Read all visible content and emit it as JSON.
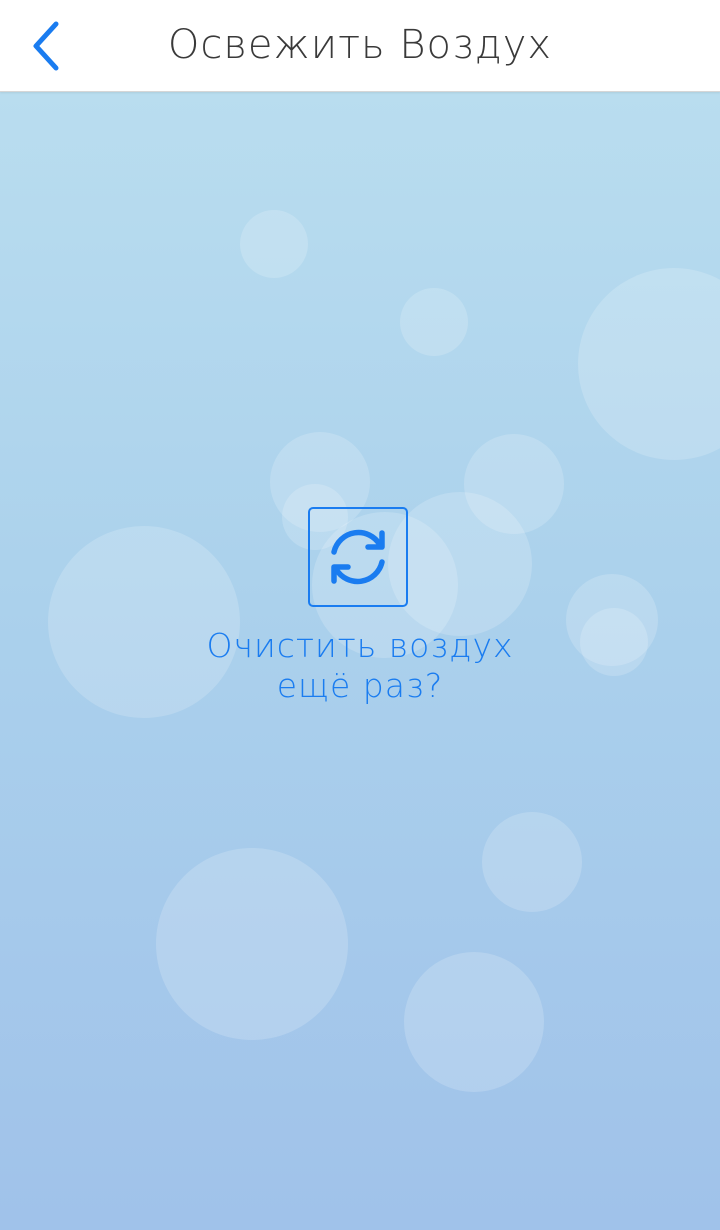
{
  "navbar": {
    "title": "Освежить Воздух",
    "back_icon": "chevron-left-icon"
  },
  "main": {
    "refresh_icon": "refresh-icon",
    "prompt_line1": "Очистить воздух",
    "prompt_line2": "ещё раз?"
  },
  "colors": {
    "accent": "#1a7cf0",
    "background_top": "#b9ddef",
    "background_bottom": "#a0c2ea",
    "navbar_bg": "#ffffff",
    "title_text": "#3a3a3a"
  }
}
